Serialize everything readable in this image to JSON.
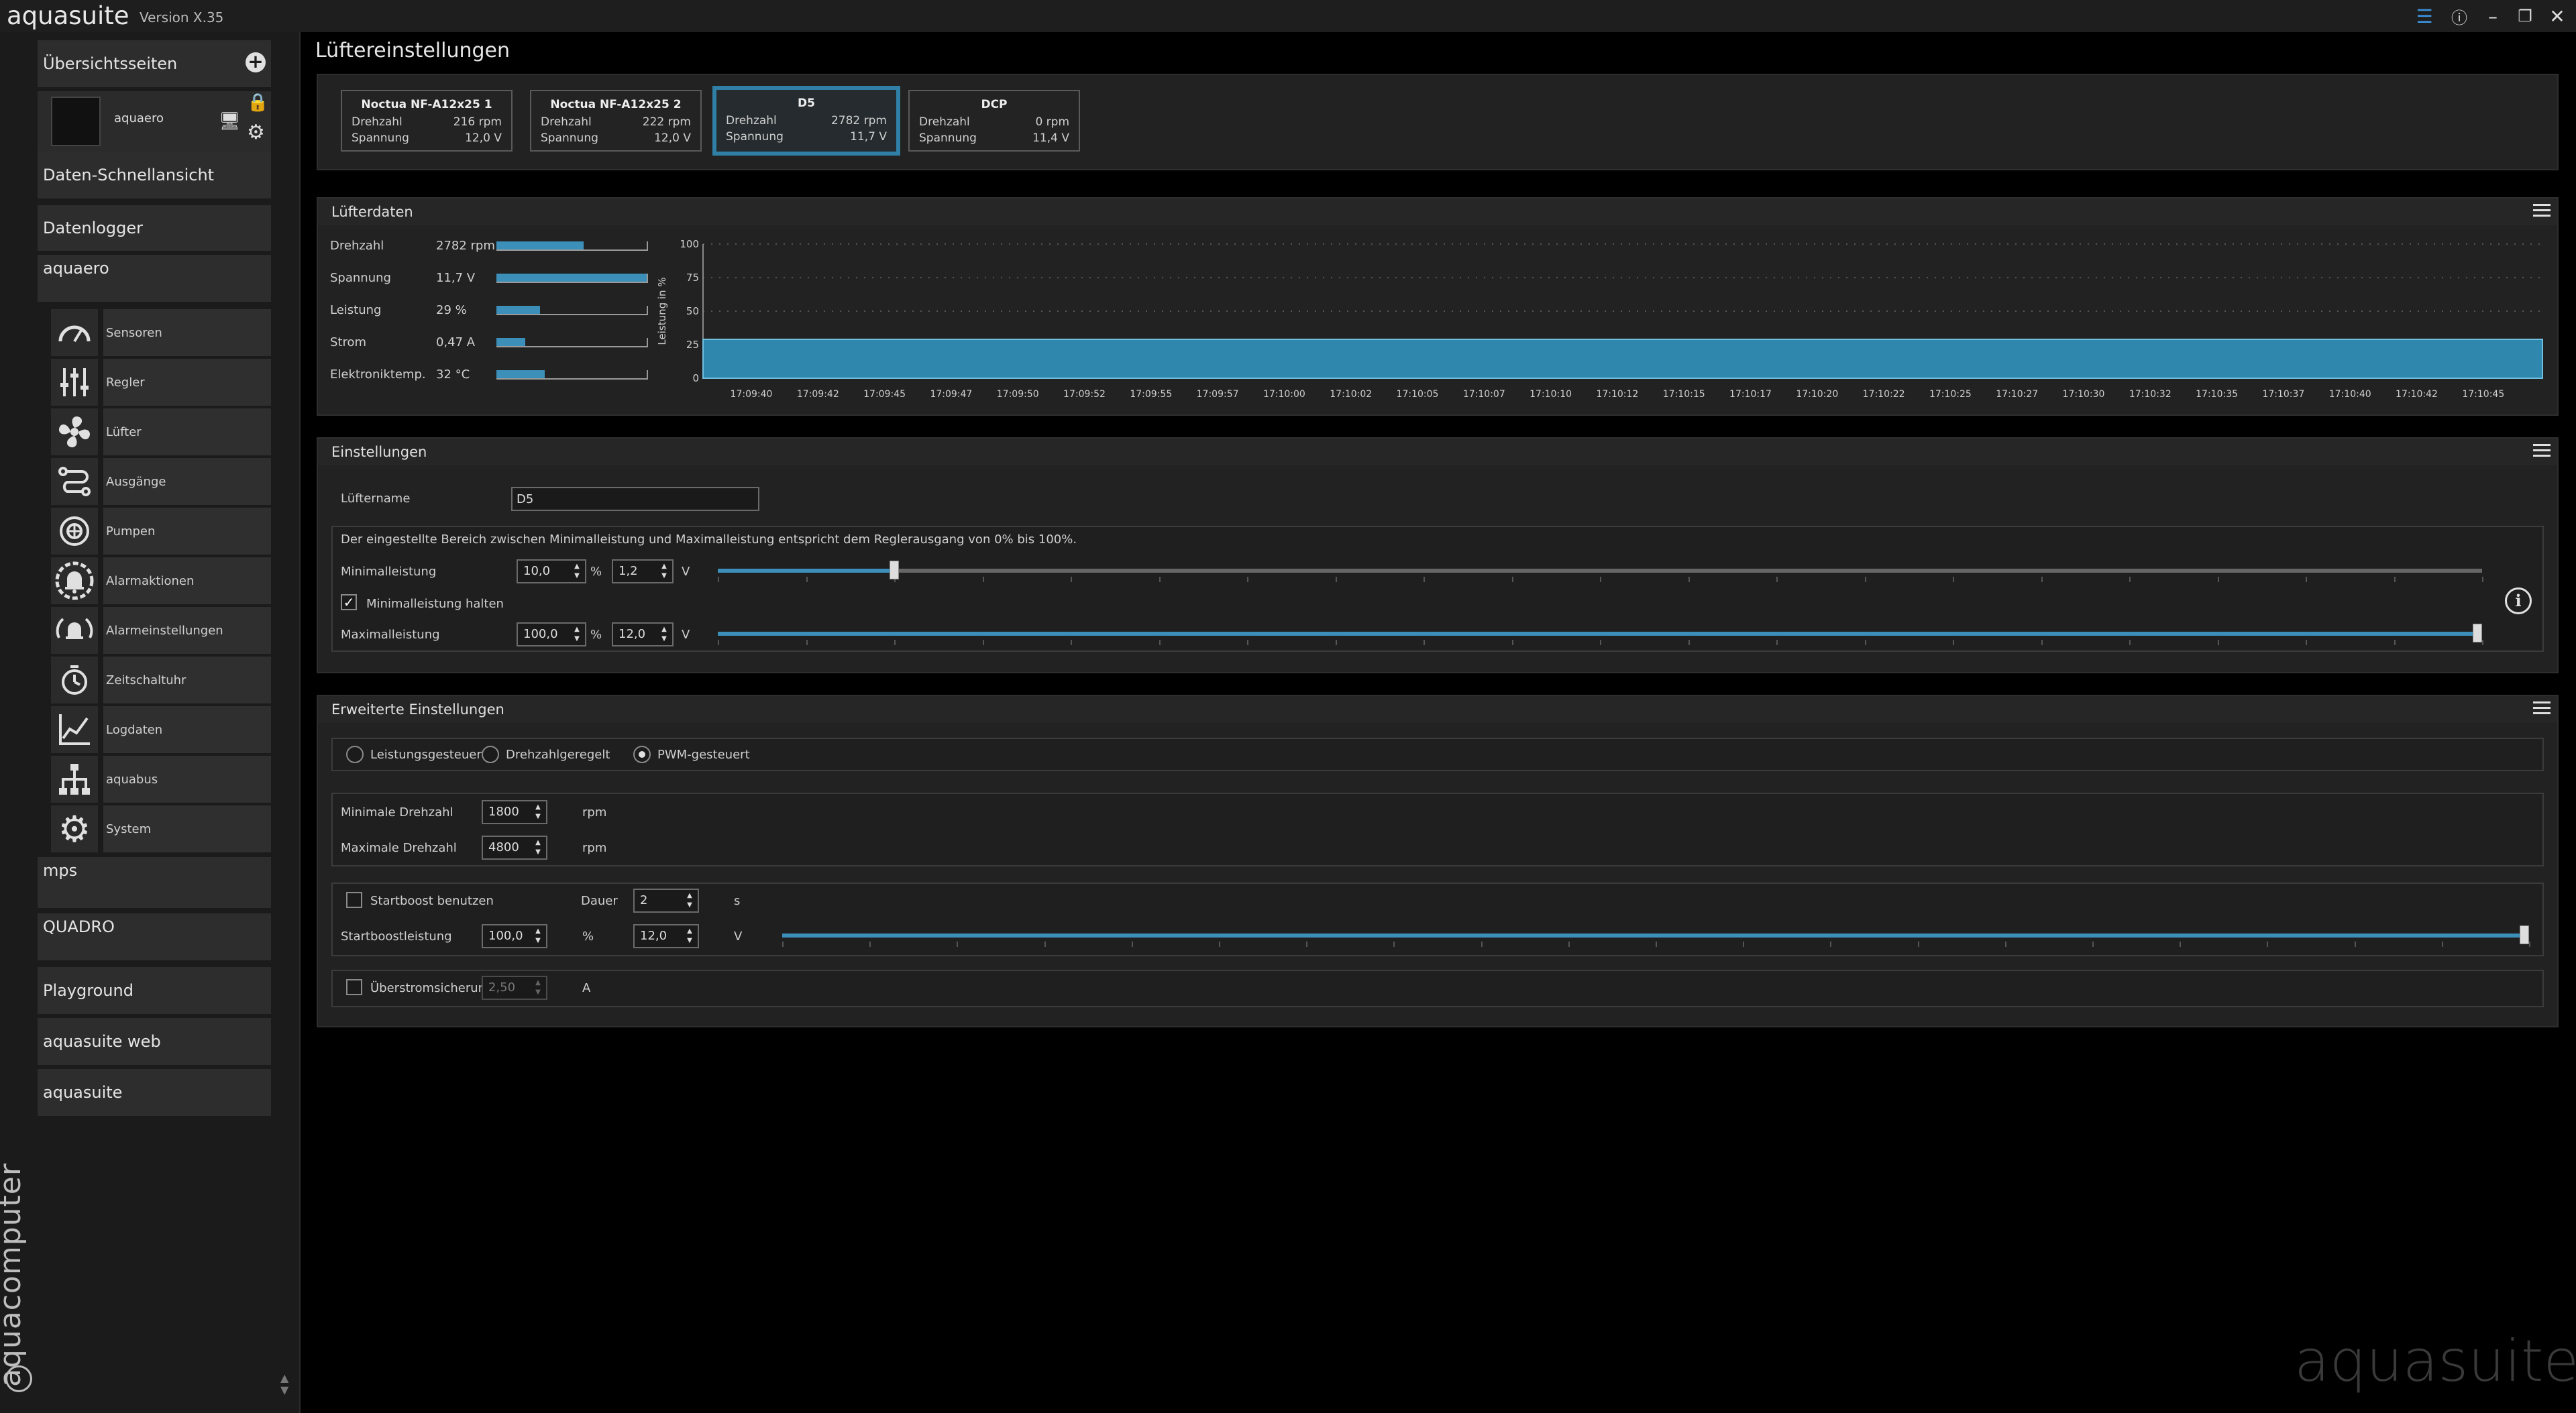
{
  "app": {
    "name": "aquasuite",
    "version": "Version X.35",
    "brand_vertical": "aquacomputer",
    "watermark": "aquasuite"
  },
  "sidebar": {
    "overview": "Übersichtsseiten",
    "device_tile": "aquaero",
    "items_top": [
      "Daten-Schnellansicht",
      "Datenlogger"
    ],
    "aquaero_header": "aquaero",
    "sub_items": [
      {
        "label": "Sensoren",
        "icon": "gauge-icon"
      },
      {
        "label": "Regler",
        "icon": "sliders-icon"
      },
      {
        "label": "Lüfter",
        "icon": "fan-icon"
      },
      {
        "label": "Ausgänge",
        "icon": "outputs-icon"
      },
      {
        "label": "Pumpen",
        "icon": "pump-icon"
      },
      {
        "label": "Alarmaktionen",
        "icon": "alarm-bell-icon"
      },
      {
        "label": "Alarmeinstellungen",
        "icon": "alarm-settings-icon"
      },
      {
        "label": "Zeitschaltuhr",
        "icon": "timer-icon"
      },
      {
        "label": "Logdaten",
        "icon": "chart-icon"
      },
      {
        "label": "aquabus",
        "icon": "network-icon"
      },
      {
        "label": "System",
        "icon": "gear-icon"
      }
    ],
    "items_bottom": [
      "mps",
      "QUADRO",
      "Playground",
      "aquasuite web",
      "aquasuite"
    ]
  },
  "page_title": "Lüftereinstellungen",
  "fans": [
    {
      "name": "Noctua NF-A12x25 1",
      "drehzahl_label": "Drehzahl",
      "drehzahl": "216 rpm",
      "spannung_label": "Spannung",
      "spannung": "12,0 V",
      "selected": false
    },
    {
      "name": "Noctua NF-A12x25 2",
      "drehzahl_label": "Drehzahl",
      "drehzahl": "222 rpm",
      "spannung_label": "Spannung",
      "spannung": "12,0 V",
      "selected": false
    },
    {
      "name": "D5",
      "drehzahl_label": "Drehzahl",
      "drehzahl": "2782 rpm",
      "spannung_label": "Spannung",
      "spannung": "11,7 V",
      "selected": true
    },
    {
      "name": "DCP",
      "drehzahl_label": "Drehzahl",
      "drehzahl": "0 rpm",
      "spannung_label": "Spannung",
      "spannung": "11,4 V",
      "selected": false
    }
  ],
  "fan_data": {
    "title": "Lüfterdaten",
    "rows": [
      {
        "label": "Drehzahl",
        "value": "2782 rpm",
        "fraction": 0.58
      },
      {
        "label": "Spannung",
        "value": "11,7 V",
        "fraction": 1.0
      },
      {
        "label": "Leistung",
        "value": "29 %",
        "fraction": 0.29
      },
      {
        "label": "Strom",
        "value": "0,47 A",
        "fraction": 0.19
      },
      {
        "label": "Elektroniktemp.",
        "value": "32 °C",
        "fraction": 0.32
      }
    ]
  },
  "chart_data": {
    "type": "area",
    "ylabel": "Leistung in %",
    "ylim": [
      0,
      100
    ],
    "yticks": [
      "100",
      "75",
      "50",
      "25",
      "0"
    ],
    "x": [
      "17:09:40",
      "17:09:42",
      "17:09:45",
      "17:09:47",
      "17:09:50",
      "17:09:52",
      "17:09:55",
      "17:09:57",
      "17:10:00",
      "17:10:02",
      "17:10:05",
      "17:10:07",
      "17:10:10",
      "17:10:12",
      "17:10:15",
      "17:10:17",
      "17:10:20",
      "17:10:22",
      "17:10:25",
      "17:10:27",
      "17:10:30",
      "17:10:32",
      "17:10:35",
      "17:10:37",
      "17:10:40",
      "17:10:42",
      "17:10:45"
    ],
    "values": [
      29,
      29,
      29,
      29,
      29,
      29,
      29,
      29,
      29,
      29,
      29,
      29,
      29,
      29,
      29,
      29,
      29,
      29,
      29,
      29,
      29,
      29,
      29,
      29,
      29,
      29,
      29
    ],
    "color": "#2f87ad"
  },
  "settings": {
    "title": "Einstellungen",
    "fan_name_label": "Lüftername",
    "fan_name_value": "D5",
    "info_text": "Der eingestellte Bereich zwischen Minimalleistung und Maximalleistung entspricht dem Reglerausgang von 0% bis 100%.",
    "min_label": "Minimalleistung",
    "min_percent": "10,0",
    "min_volt": "1,2",
    "min_fraction": 0.1,
    "hold_min_label": "Minimalleistung halten",
    "hold_min_checked": true,
    "max_label": "Maximalleistung",
    "max_percent": "100,0",
    "max_volt": "12,0",
    "max_fraction": 1.0,
    "unit_percent": "%",
    "unit_volt": "V"
  },
  "advanced": {
    "title": "Erweiterte Einstellungen",
    "modes": [
      {
        "label": "Leistungsgesteuert",
        "checked": false
      },
      {
        "label": "Drehzahlgeregelt",
        "checked": false
      },
      {
        "label": "PWM-gesteuert",
        "checked": true
      }
    ],
    "min_rpm_label": "Minimale Drehzahl",
    "min_rpm": "1800",
    "max_rpm_label": "Maximale Drehzahl",
    "max_rpm": "4800",
    "rpm_unit": "rpm",
    "startboost_label": "Startboost benutzen",
    "duration_label": "Dauer",
    "duration": "2",
    "duration_unit": "s",
    "boost_power_label": "Startboostleistung",
    "boost_percent": "100,0",
    "boost_volt": "12,0",
    "boost_fraction": 1.0,
    "overcurrent_label": "Überstromsicherung",
    "overcurrent_value": "2,50",
    "overcurrent_unit": "A"
  }
}
